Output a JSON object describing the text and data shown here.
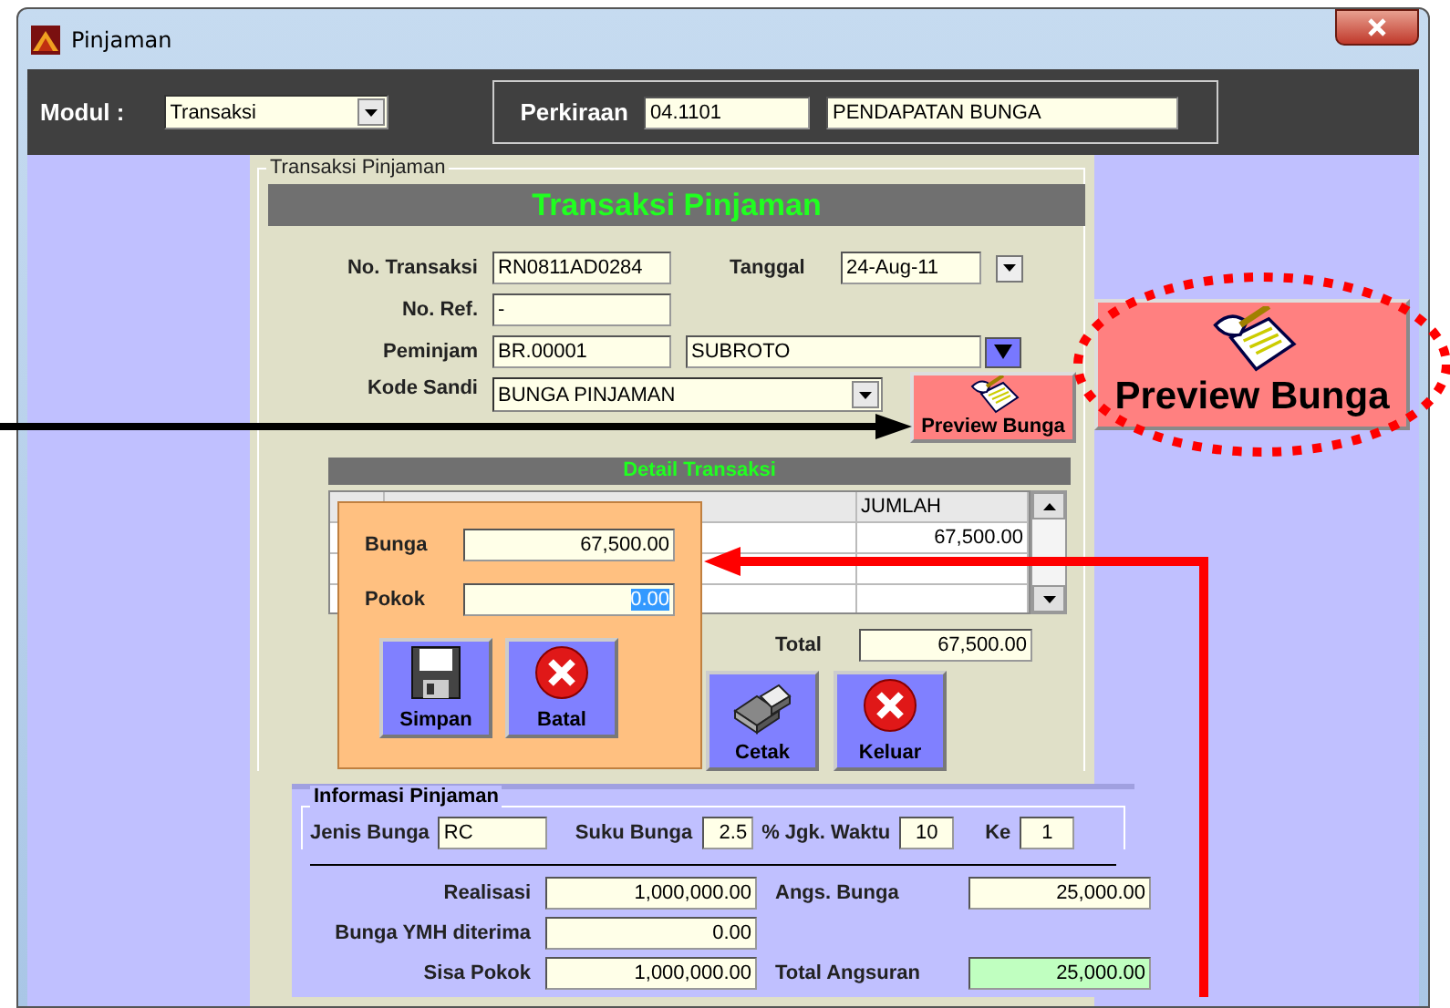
{
  "window": {
    "title": "Pinjaman"
  },
  "toolbar": {
    "module_label": "Modul :",
    "module_value": "Transaksi",
    "account_label": "Perkiraan",
    "account_code": "04.1101",
    "account_name": "PENDAPATAN BUNGA"
  },
  "form": {
    "group_title": "Transaksi Pinjaman",
    "heading": "Transaksi Pinjaman",
    "no_transaksi": {
      "label": "No. Transaksi",
      "value": "RN0811AD0284"
    },
    "tanggal": {
      "label": "Tanggal",
      "value": "24-Aug-11"
    },
    "no_ref": {
      "label": "No. Ref.",
      "value": "-"
    },
    "peminjam": {
      "label": "Peminjam",
      "code": "BR.00001",
      "name": "SUBROTO"
    },
    "kode_sandi": {
      "label": "Kode Sandi",
      "value": "BUNGA PINJAMAN"
    },
    "preview_button": "Preview Bunga"
  },
  "detail": {
    "title": "Detail Transaksi",
    "amount_column": "JUMLAH",
    "rows": [
      {
        "amount": "67,500.00"
      }
    ],
    "total_label": "Total",
    "total_value": "67,500.00",
    "buttons": [
      {
        "label": "Cetak",
        "kind": "print"
      },
      {
        "label": "Keluar",
        "kind": "cancel"
      }
    ]
  },
  "popup": {
    "fields": [
      {
        "label": "Bunga",
        "value": "67,500.00",
        "text_selected": false
      },
      {
        "label": "Pokok",
        "value": "0.00",
        "text_selected": true
      }
    ],
    "buttons": [
      {
        "label": "Simpan",
        "kind": "save"
      },
      {
        "label": "Batal",
        "kind": "cancel"
      }
    ]
  },
  "info": {
    "title": "Informasi Pinjaman",
    "jenis_bunga": {
      "label": "Jenis Bunga",
      "value": "RC"
    },
    "suku_bunga": {
      "label": "Suku Bunga",
      "value": "2.5"
    },
    "jangka_waktu": {
      "label": "% Jgk. Waktu",
      "value": "10"
    },
    "ke": {
      "label": "Ke",
      "value": "1"
    },
    "realisasi": {
      "label": "Realisasi",
      "value": "1,000,000.00"
    },
    "angs_bunga": {
      "label": "Angs. Bunga",
      "value": "25,000.00"
    },
    "bunga_ymh": {
      "label": "Bunga YMH diterima",
      "value": "0.00"
    },
    "sisa_pokok": {
      "label": "Sisa Pokok",
      "value": "1,000,000.00"
    },
    "total_angsuran": {
      "label": "Total Angsuran",
      "value": "25,000.00"
    }
  },
  "callout": {
    "label": "Preview Bunga"
  }
}
